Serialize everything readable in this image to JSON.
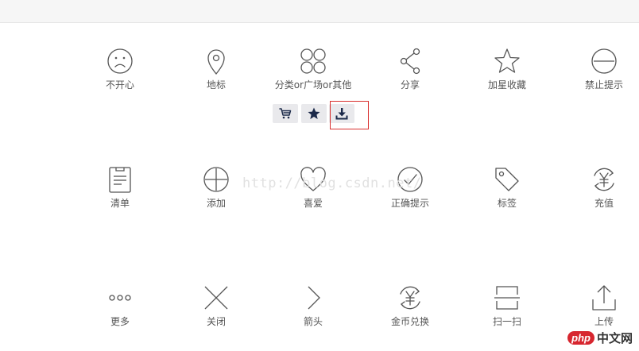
{
  "rows": [
    {
      "items": [
        {
          "icon": "sad-face-icon",
          "label": "不开心"
        },
        {
          "icon": "location-pin-icon",
          "label": "地标"
        },
        {
          "icon": "category-grid-icon",
          "label": "分类or广场or其他"
        },
        {
          "icon": "share-icon",
          "label": "分享"
        },
        {
          "icon": "star-outline-icon",
          "label": "加星收藏"
        },
        {
          "icon": "forbidden-minus-icon",
          "label": "禁止提示"
        }
      ]
    },
    {
      "items": [
        {
          "icon": "checklist-clipboard-icon",
          "label": "清单"
        },
        {
          "icon": "add-circle-icon",
          "label": "添加"
        },
        {
          "icon": "heart-icon",
          "label": "喜爱"
        },
        {
          "icon": "check-circle-icon",
          "label": "正确提示"
        },
        {
          "icon": "tag-icon",
          "label": "标签"
        },
        {
          "icon": "recharge-yen-icon",
          "label": "充值"
        }
      ]
    },
    {
      "items": [
        {
          "icon": "more-dots-icon",
          "label": "更多"
        },
        {
          "icon": "close-x-icon",
          "label": "关闭"
        },
        {
          "icon": "arrow-right-icon",
          "label": "箭头"
        },
        {
          "icon": "coin-exchange-icon",
          "label": "金币兑换"
        },
        {
          "icon": "scan-icon",
          "label": "扫一扫"
        },
        {
          "icon": "upload-icon",
          "label": "上传"
        }
      ]
    }
  ],
  "toolbar": {
    "buttons": [
      {
        "icon": "cart-icon"
      },
      {
        "icon": "star-filled-icon"
      },
      {
        "icon": "download-icon",
        "highlighted": true
      }
    ]
  },
  "watermark": "http://blog.csdn.net/",
  "badge": {
    "php": "php",
    "cn": "中文网"
  },
  "colors": {
    "icon_stroke": "#555555",
    "button_icon": "#1c2a4a",
    "highlight": "#d9302f"
  }
}
